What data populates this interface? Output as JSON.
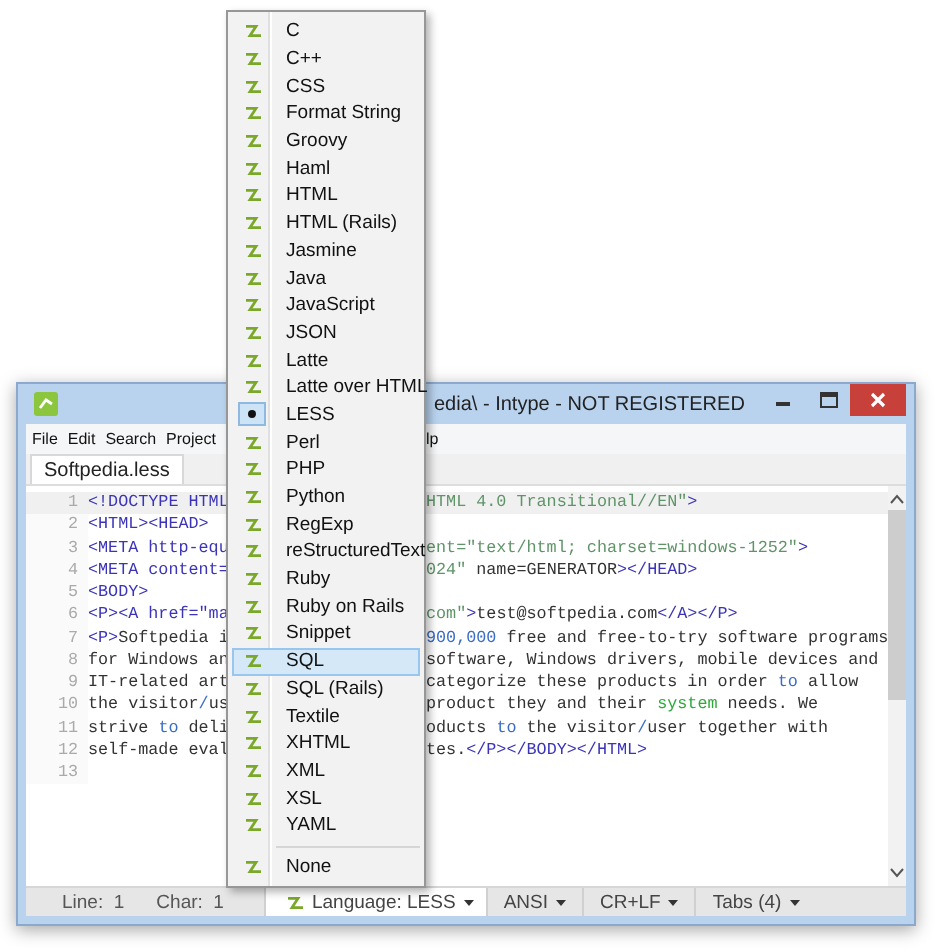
{
  "window": {
    "title": "edia\\ - Intype  - NOT REGISTERED"
  },
  "menu_bar": [
    "File",
    "Edit",
    "Search",
    "Project",
    "lp"
  ],
  "tabs": [
    {
      "label": "Softpedia.less",
      "selected": true
    }
  ],
  "editor": {
    "lines": [
      {
        "number": "1",
        "current": true,
        "left": [
          {
            "kind": "tag",
            "text": "<!DOCTYPE HTML"
          }
        ],
        "right": [
          {
            "kind": "str",
            "text": "HTML 4.0 Transitional//EN\""
          },
          {
            "kind": "tag",
            "text": ">"
          }
        ]
      },
      {
        "number": "2",
        "current": false,
        "left": [
          {
            "kind": "tag",
            "text": "<HTML><HEAD>"
          }
        ]
      },
      {
        "number": "3",
        "current": false,
        "left": [
          {
            "kind": "tag",
            "text": "<META http-equ"
          }
        ],
        "right": [
          {
            "kind": "str",
            "text": "ent=\"text/html; charset=windows-1252\""
          },
          {
            "kind": "tag",
            "text": ">"
          }
        ]
      },
      {
        "number": "4",
        "current": false,
        "left": [
          {
            "kind": "tag",
            "text": "<META content="
          }
        ],
        "right": [
          {
            "kind": "str",
            "text": "024\""
          },
          {
            "kind": "txt",
            "text": " name=GENERATOR"
          },
          {
            "kind": "tag",
            "text": "></HEAD>"
          }
        ]
      },
      {
        "number": "5",
        "current": false,
        "left": [
          {
            "kind": "tag",
            "text": "<BODY>"
          }
        ]
      },
      {
        "number": "6",
        "current": false,
        "left": [
          {
            "kind": "tag",
            "text": "<P><A href=\"ma"
          }
        ],
        "right": [
          {
            "kind": "str",
            "text": "com\""
          },
          {
            "kind": "tag",
            "text": ">"
          },
          {
            "kind": "txt",
            "text": "test@softpedia.com"
          },
          {
            "kind": "tag",
            "text": "</A></P>"
          }
        ]
      },
      {
        "number": "7",
        "current": false,
        "left": [
          {
            "kind": "tag",
            "text": "<P>"
          },
          {
            "kind": "txt",
            "text": "Softpedia i"
          }
        ],
        "right": [
          {
            "kind": "kw",
            "text": "900,000"
          },
          {
            "kind": "txt",
            "text": " free and free-to-try software programs"
          }
        ]
      },
      {
        "number": "8",
        "current": false,
        "left": [
          {
            "kind": "txt",
            "text": "for Windows an"
          }
        ],
        "right": [
          {
            "kind": "txt",
            "text": "software, Windows drivers, mobile devices and"
          }
        ]
      },
      {
        "number": "9",
        "current": false,
        "left": [
          {
            "kind": "txt",
            "text": "IT-related art"
          }
        ],
        "right": [
          {
            "kind": "txt",
            "text": "categorize these products in order "
          },
          {
            "kind": "kw",
            "text": "to"
          },
          {
            "kind": "txt",
            "text": " allow"
          }
        ]
      },
      {
        "number": "10",
        "current": false,
        "left": [
          {
            "kind": "txt",
            "text": "the visitor"
          },
          {
            "kind": "kw",
            "text": "/"
          },
          {
            "kind": "txt",
            "text": "us"
          }
        ],
        "right": [
          {
            "kind": "txt",
            "text": "product they and their "
          },
          {
            "kind": "sys",
            "text": "system"
          },
          {
            "kind": "txt",
            "text": " needs. We"
          }
        ]
      },
      {
        "number": "11",
        "current": false,
        "left": [
          {
            "kind": "txt",
            "text": "strive "
          },
          {
            "kind": "kw",
            "text": "to"
          },
          {
            "kind": "txt",
            "text": " deli"
          }
        ],
        "right": [
          {
            "kind": "txt",
            "text": "oducts "
          },
          {
            "kind": "kw",
            "text": "to"
          },
          {
            "kind": "txt",
            "text": " the visitor"
          },
          {
            "kind": "kw",
            "text": "/"
          },
          {
            "kind": "txt",
            "text": "user together with"
          }
        ]
      },
      {
        "number": "12",
        "current": false,
        "left": [
          {
            "kind": "txt",
            "text": "self-made eval"
          }
        ],
        "right": [
          {
            "kind": "txt",
            "text": "tes."
          },
          {
            "kind": "tag",
            "text": "</P></BODY></HTML>"
          }
        ]
      },
      {
        "number": "13",
        "current": false
      }
    ]
  },
  "status_bar": [
    {
      "kind": "text",
      "label": "Line:  1"
    },
    {
      "kind": "text",
      "label": "Char:  1"
    },
    {
      "kind": "dropdown",
      "label": "Language: LESS",
      "icon": true,
      "open": true
    },
    {
      "kind": "dropdown",
      "label": "ANSI",
      "open": false
    },
    {
      "kind": "dropdown",
      "label": "CR+LF",
      "open": false
    },
    {
      "kind": "dropdown",
      "label": "Tabs (4)",
      "open": false
    }
  ],
  "language_menu": {
    "groups": [
      [
        {
          "label": "C",
          "checked": false,
          "highlighted": false
        },
        {
          "label": "C++",
          "checked": false,
          "highlighted": false
        },
        {
          "label": "CSS",
          "checked": false,
          "highlighted": false
        },
        {
          "label": "Format String",
          "checked": false,
          "highlighted": false
        },
        {
          "label": "Groovy",
          "checked": false,
          "highlighted": false
        },
        {
          "label": "Haml",
          "checked": false,
          "highlighted": false
        },
        {
          "label": "HTML",
          "checked": false,
          "highlighted": false
        },
        {
          "label": "HTML (Rails)",
          "checked": false,
          "highlighted": false
        },
        {
          "label": "Jasmine",
          "checked": false,
          "highlighted": false
        },
        {
          "label": "Java",
          "checked": false,
          "highlighted": false
        },
        {
          "label": "JavaScript",
          "checked": false,
          "highlighted": false
        },
        {
          "label": "JSON",
          "checked": false,
          "highlighted": false
        },
        {
          "label": "Latte",
          "checked": false,
          "highlighted": false
        },
        {
          "label": "Latte over HTML",
          "checked": false,
          "highlighted": false
        },
        {
          "label": "LESS",
          "checked": true,
          "highlighted": false
        },
        {
          "label": "Perl",
          "checked": false,
          "highlighted": false
        },
        {
          "label": "PHP",
          "checked": false,
          "highlighted": false
        },
        {
          "label": "Python",
          "checked": false,
          "highlighted": false
        },
        {
          "label": "RegExp",
          "checked": false,
          "highlighted": false
        },
        {
          "label": "reStructuredText",
          "checked": false,
          "highlighted": false
        },
        {
          "label": "Ruby",
          "checked": false,
          "highlighted": false
        },
        {
          "label": "Ruby on Rails",
          "checked": false,
          "highlighted": false
        },
        {
          "label": "Snippet",
          "checked": false,
          "highlighted": false
        },
        {
          "label": "SQL",
          "checked": false,
          "highlighted": true
        },
        {
          "label": "SQL (Rails)",
          "checked": false,
          "highlighted": false
        },
        {
          "label": "Textile",
          "checked": false,
          "highlighted": false
        },
        {
          "label": "XHTML",
          "checked": false,
          "highlighted": false
        },
        {
          "label": "XML",
          "checked": false,
          "highlighted": false
        },
        {
          "label": "XSL",
          "checked": false,
          "highlighted": false
        },
        {
          "label": "YAML",
          "checked": false,
          "highlighted": false
        }
      ],
      [
        {
          "label": "None",
          "checked": false,
          "highlighted": false
        }
      ]
    ]
  }
}
